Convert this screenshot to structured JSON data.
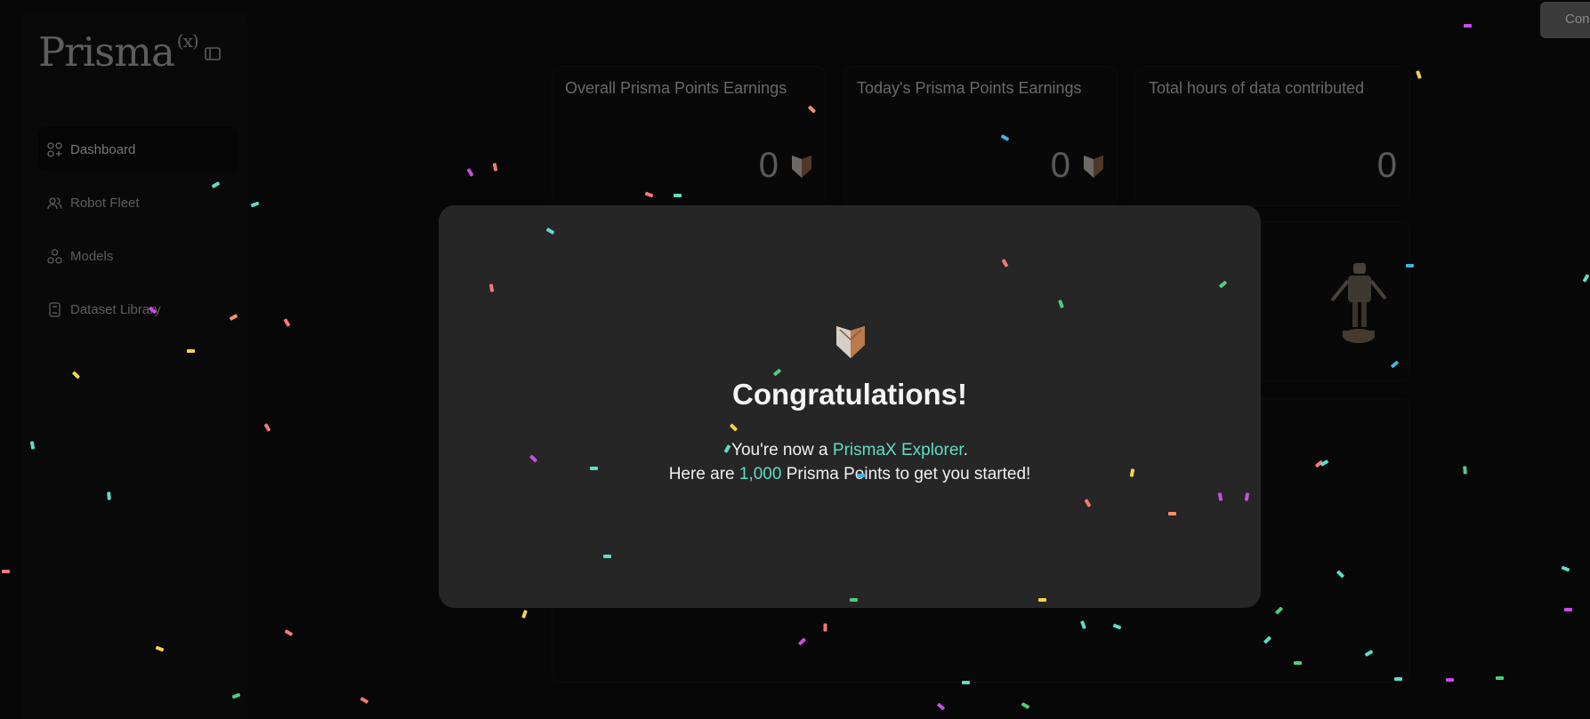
{
  "brand": {
    "name": "Prisma",
    "superscript": "(x)"
  },
  "sidebar": {
    "items": [
      {
        "label": "Dashboard",
        "icon": "dashboard-icon",
        "active": true
      },
      {
        "label": "Robot Fleet",
        "icon": "users-icon",
        "active": false
      },
      {
        "label": "Models",
        "icon": "models-icon",
        "active": false
      },
      {
        "label": "Dataset Library",
        "icon": "book-icon",
        "active": false
      }
    ]
  },
  "header": {
    "top_button_label": "Con"
  },
  "stats": [
    {
      "title": "Overall Prisma Points Earnings",
      "value": "0",
      "has_badge": true
    },
    {
      "title": "Today's Prisma Points Earnings",
      "value": "0",
      "has_badge": true
    },
    {
      "title": "Total hours of data contributed",
      "value": "0",
      "has_badge": false
    }
  ],
  "modal": {
    "title": "Congratulations!",
    "line1_prefix": "You're now a ",
    "line1_highlight": "PrismaX Explorer",
    "line1_suffix": ".",
    "line2_prefix": "Here are ",
    "line2_highlight": "1,000",
    "line2_suffix": " Prisma Points to get you started!"
  },
  "colors": {
    "accent": "#5fdcc5",
    "background": "#0b0b0b",
    "modal": "#262626",
    "confetti": [
      "#5fdcc5",
      "#f2787a",
      "#c84de6",
      "#f7d24a",
      "#4bd07c",
      "#f58f6b",
      "#3fb3e0"
    ]
  }
}
